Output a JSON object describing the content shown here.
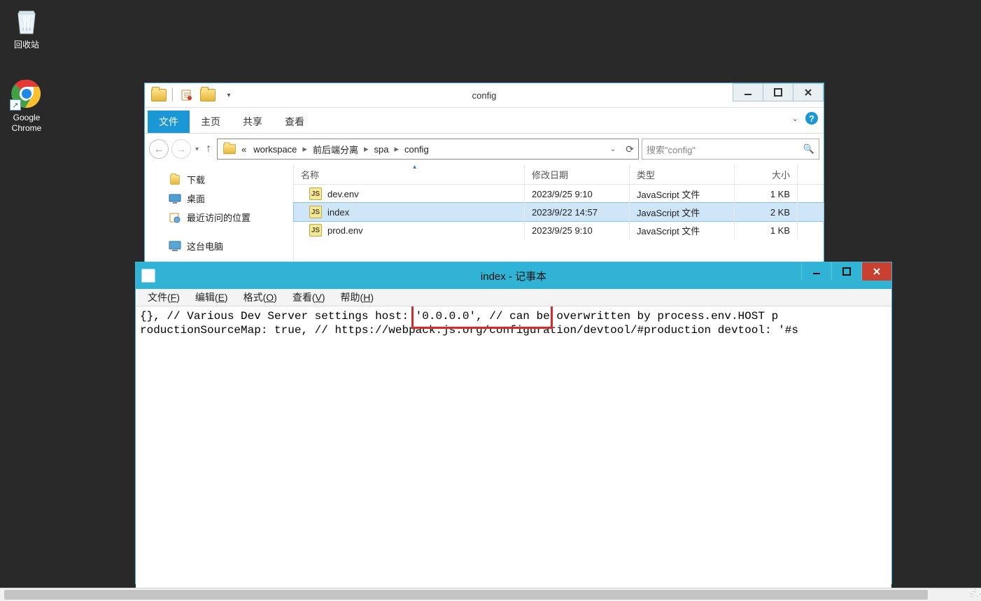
{
  "desktop": {
    "recycle_bin": "回收站",
    "chrome": "Google\nChrome"
  },
  "explorer": {
    "title": "config",
    "ribbon": {
      "file": "文件",
      "home": "主页",
      "share": "共享",
      "view": "查看"
    },
    "crumbs": {
      "prefix": "«",
      "c1": "workspace",
      "c2": "前后端分离",
      "c3": "spa",
      "c4": "config"
    },
    "search_placeholder": "搜索\"config\"",
    "nav": {
      "downloads": "下载",
      "desktop": "桌面",
      "recent": "最近访问的位置",
      "computer": "这台电脑"
    },
    "cols": {
      "name": "名称",
      "date": "修改日期",
      "type": "类型",
      "size": "大小"
    },
    "rows": [
      {
        "name": "dev.env",
        "date": "2023/9/25 9:10",
        "type": "JavaScript 文件",
        "size": "1 KB",
        "selected": false
      },
      {
        "name": "index",
        "date": "2023/9/22 14:57",
        "type": "JavaScript 文件",
        "size": "2 KB",
        "selected": true
      },
      {
        "name": "prod.env",
        "date": "2023/9/25 9:10",
        "type": "JavaScript 文件",
        "size": "1 KB",
        "selected": false
      }
    ]
  },
  "notepad": {
    "title": "index - 记事本",
    "menu": {
      "file": "文件(F)",
      "edit": "编辑(E)",
      "format": "格式(O)",
      "view": "查看(V)",
      "help": "帮助(H)"
    },
    "line1_a": "{},    // Various Dev Server settings   ",
    "line1_hl": " host: '0.0.0.0', ",
    "line1_b": "// can be overwritten by process.env.HOST    p",
    "line2": "roductionSourceMap: true,    // https://webpack.js.org/configuration/devtool/#production    devtool: '#s"
  }
}
